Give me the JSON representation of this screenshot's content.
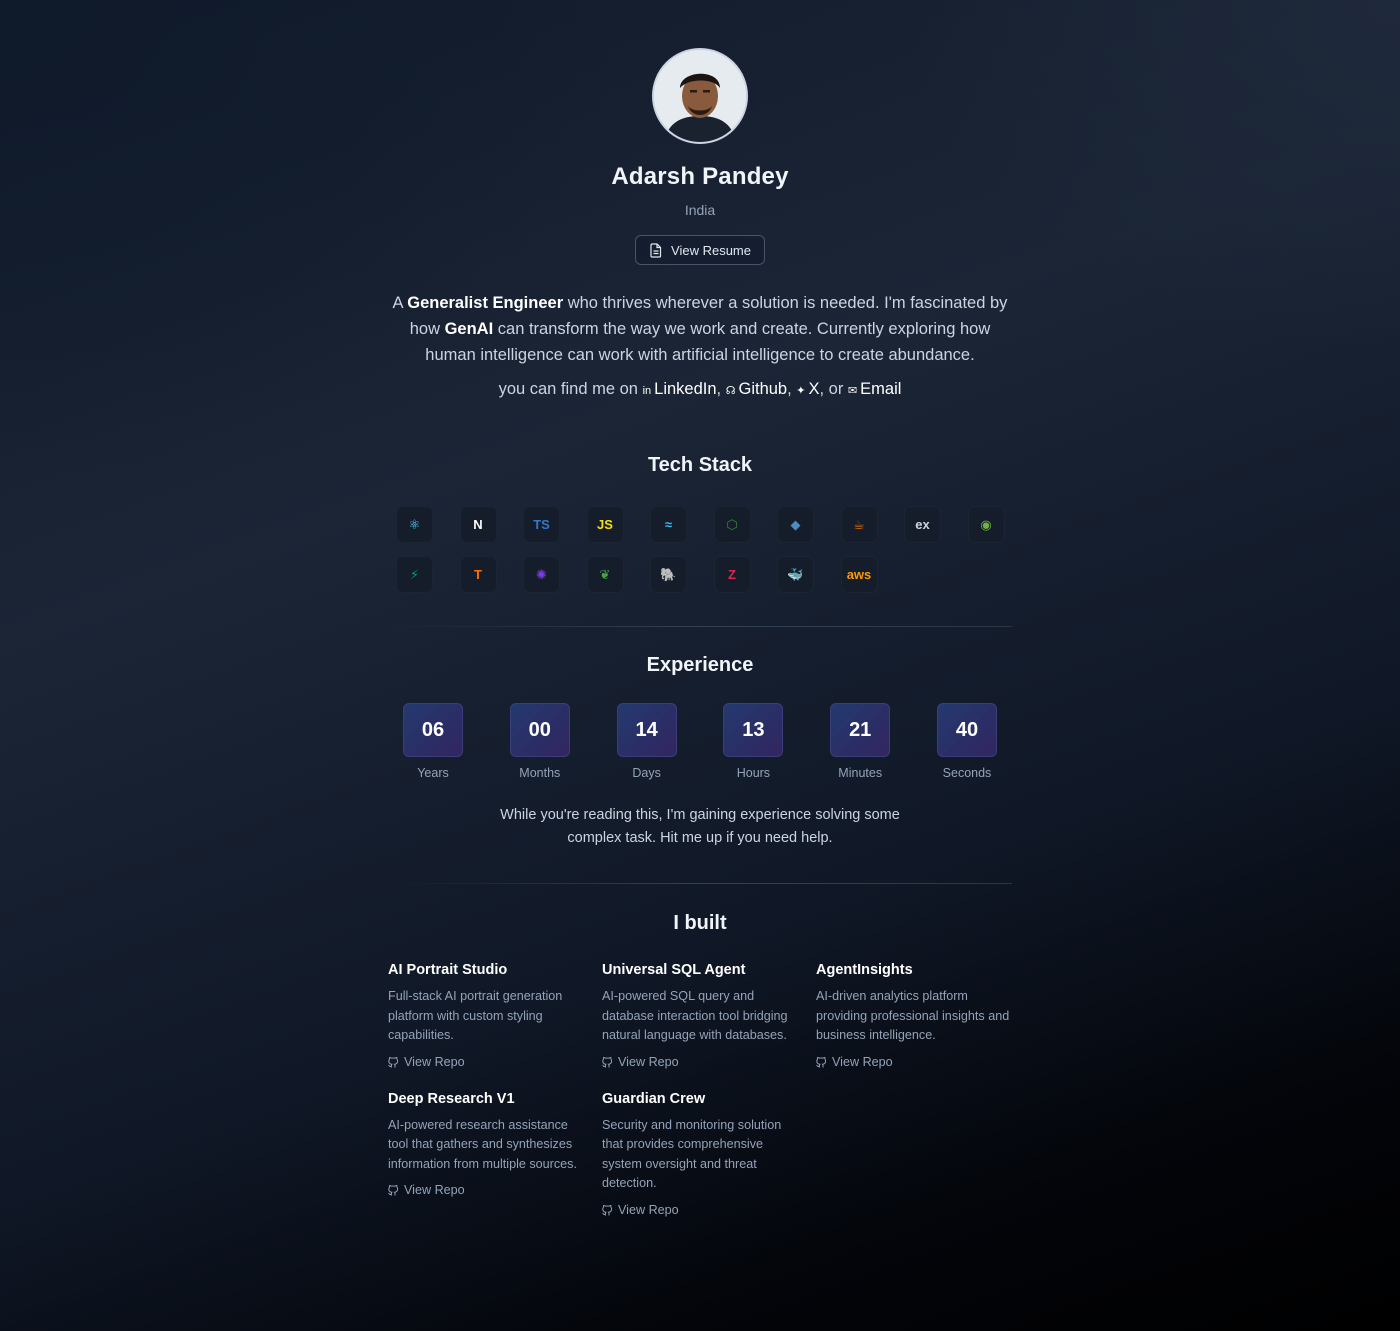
{
  "profile": {
    "name": "Adarsh Pandey",
    "location": "India",
    "resume_label": "View Resume"
  },
  "bio": {
    "p1": "A ",
    "b1": "Generalist Engineer",
    "p2": " who thrives wherever a solution is needed. I'm fascinated by how ",
    "b2": "GenAI",
    "p3": " can transform the way we work and create. Currently exploring how human intelligence can work with artificial intelligence to create abundance."
  },
  "social": {
    "intro": "you can find me on ",
    "linkedin": "LinkedIn",
    "github": "Github",
    "x": "X",
    "email": "Email",
    "sep1": ", ",
    "sep2": ", ",
    "sep3": ", or "
  },
  "tech_stack": {
    "title": "Tech Stack",
    "icons": [
      {
        "name": "react-icon",
        "glyph": "⚛",
        "color": "#61dafb"
      },
      {
        "name": "nextjs-icon",
        "glyph": "N",
        "color": "#ffffff"
      },
      {
        "name": "typescript-icon",
        "glyph": "TS",
        "color": "#3178c6"
      },
      {
        "name": "javascript-icon",
        "glyph": "JS",
        "color": "#f7df1e"
      },
      {
        "name": "tailwind-icon",
        "glyph": "≈",
        "color": "#38bdf8"
      },
      {
        "name": "nodejs-icon",
        "glyph": "⬡",
        "color": "#3c873a"
      },
      {
        "name": "python-icon",
        "glyph": "◆",
        "color": "#4b8bbe"
      },
      {
        "name": "java-icon",
        "glyph": "☕",
        "color": "#e76f00"
      },
      {
        "name": "express-icon",
        "glyph": "ex",
        "color": "#cbd5e1"
      },
      {
        "name": "spring-icon",
        "glyph": "◉",
        "color": "#6db33f"
      },
      {
        "name": "fastapi-icon",
        "glyph": "⚡",
        "color": "#009688"
      },
      {
        "name": "tensorflow-icon",
        "glyph": "T",
        "color": "#ff6f00"
      },
      {
        "name": "openai-icon",
        "glyph": "✺",
        "color": "#7c3aed"
      },
      {
        "name": "mongodb-icon",
        "glyph": "❦",
        "color": "#47a248"
      },
      {
        "name": "postgresql-icon",
        "glyph": "🐘",
        "color": "#336791"
      },
      {
        "name": "nestjs-icon",
        "glyph": "Z",
        "color": "#e0234e"
      },
      {
        "name": "docker-icon",
        "glyph": "🐳",
        "color": "#2496ed"
      },
      {
        "name": "aws-icon",
        "glyph": "aws",
        "color": "#ff9900"
      }
    ]
  },
  "experience": {
    "title": "Experience",
    "units": [
      {
        "value": "06",
        "label": "Years"
      },
      {
        "value": "00",
        "label": "Months"
      },
      {
        "value": "14",
        "label": "Days"
      },
      {
        "value": "13",
        "label": "Hours"
      },
      {
        "value": "21",
        "label": "Minutes"
      },
      {
        "value": "40",
        "label": "Seconds"
      }
    ],
    "note_line1": "While you're reading this, I'm gaining experience solving some",
    "note_line2": "complex task. Hit me up if you need help."
  },
  "projects": {
    "title": "I built",
    "repo_label": "View Repo",
    "items": [
      {
        "title": "AI Portrait Studio",
        "desc": "Full-stack AI portrait generation platform with custom styling capabilities."
      },
      {
        "title": "Universal SQL Agent",
        "desc": "AI-powered SQL query and database interaction tool bridging natural language with databases."
      },
      {
        "title": "AgentInsights",
        "desc": "AI-driven analytics platform providing professional insights and business intelligence."
      },
      {
        "title": "Deep Research V1",
        "desc": "AI-powered research assistance tool that gathers and synthesizes information from multiple sources."
      },
      {
        "title": "Guardian Crew",
        "desc": "Security and monitoring solution that provides comprehensive system oversight and threat detection."
      }
    ]
  }
}
